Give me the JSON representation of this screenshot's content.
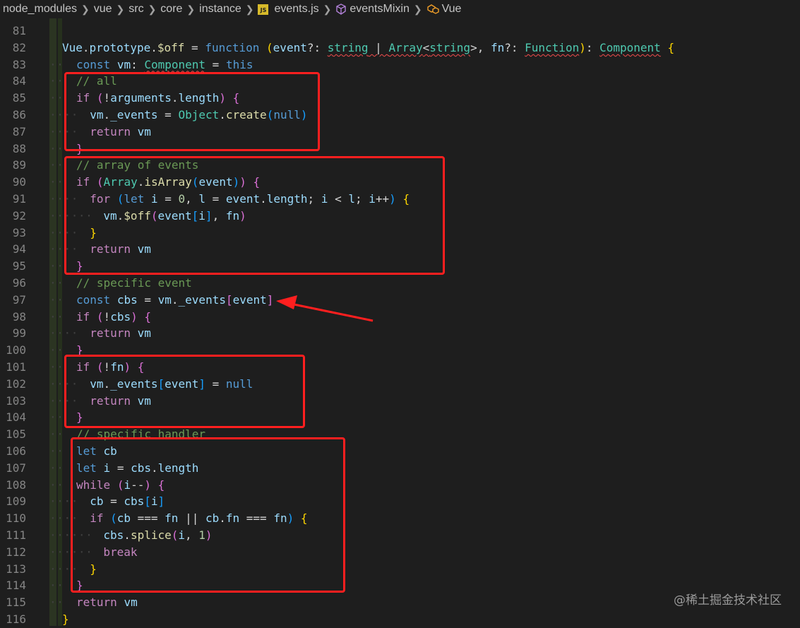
{
  "breadcrumb": {
    "items": [
      "node_modules",
      "vue",
      "src",
      "core",
      "instance"
    ],
    "file": "events.js",
    "file_icon_label": "JS",
    "symbol": "eventsMixin",
    "symbol2": "Vue"
  },
  "lines": [
    {
      "n": "81",
      "dots": ""
    },
    {
      "n": "82",
      "dots": ""
    },
    {
      "n": "83",
      "dots": "··"
    },
    {
      "n": "84",
      "dots": "··"
    },
    {
      "n": "85",
      "dots": "··"
    },
    {
      "n": "86",
      "dots": "····"
    },
    {
      "n": "87",
      "dots": "····"
    },
    {
      "n": "88",
      "dots": "··"
    },
    {
      "n": "89",
      "dots": "··"
    },
    {
      "n": "90",
      "dots": "··"
    },
    {
      "n": "91",
      "dots": "····"
    },
    {
      "n": "92",
      "dots": "······"
    },
    {
      "n": "93",
      "dots": "····"
    },
    {
      "n": "94",
      "dots": "····"
    },
    {
      "n": "95",
      "dots": "··"
    },
    {
      "n": "96",
      "dots": "··"
    },
    {
      "n": "97",
      "dots": "··"
    },
    {
      "n": "98",
      "dots": "··"
    },
    {
      "n": "99",
      "dots": "····"
    },
    {
      "n": "100",
      "dots": "··"
    },
    {
      "n": "101",
      "dots": "··"
    },
    {
      "n": "102",
      "dots": "····"
    },
    {
      "n": "103",
      "dots": "····"
    },
    {
      "n": "104",
      "dots": "··"
    },
    {
      "n": "105",
      "dots": "··"
    },
    {
      "n": "106",
      "dots": "··"
    },
    {
      "n": "107",
      "dots": "··"
    },
    {
      "n": "108",
      "dots": "··"
    },
    {
      "n": "109",
      "dots": "····"
    },
    {
      "n": "110",
      "dots": "····"
    },
    {
      "n": "111",
      "dots": "······"
    },
    {
      "n": "112",
      "dots": "······"
    },
    {
      "n": "113",
      "dots": "····"
    },
    {
      "n": "114",
      "dots": "··"
    },
    {
      "n": "115",
      "dots": "··"
    },
    {
      "n": "116",
      "dots": ""
    }
  ],
  "code": {
    "l82": {
      "obj": "Vue",
      "p1": "prototype",
      "p2": "$off",
      "eq": " = ",
      "kw": "function",
      "arg1": "event",
      "q1": "?: ",
      "t1": "string",
      "pipe": " | ",
      "t2": "Array",
      "t3": "string",
      "arg2": "fn",
      "q2": "?: ",
      "t4": "Function",
      "ret": "Component"
    },
    "l83": {
      "kw": "const",
      "v": "vm",
      "t": "Component",
      "eq": " = ",
      "this": "this"
    },
    "l84": {
      "c": "// all"
    },
    "l85": {
      "kw": "if",
      "arg": "arguments",
      "prop": "length"
    },
    "l86": {
      "v": "vm",
      "prop": "_events",
      "eq": " = ",
      "cls": "Object",
      "fn": "create",
      "arg": "null"
    },
    "l87": {
      "kw": "return",
      "v": "vm"
    },
    "l89": {
      "c": "// array of events"
    },
    "l90": {
      "kw": "if",
      "cls": "Array",
      "fn": "isArray",
      "arg": "event"
    },
    "l91": {
      "kw": "for",
      "let": "let",
      "i": "i",
      "zero": "0",
      "l": "l",
      "ev": "event",
      "len": "length"
    },
    "l92": {
      "v": "vm",
      "fn": "$off",
      "ev": "event",
      "i": "i",
      "fnv": "fn"
    },
    "l94": {
      "kw": "return",
      "v": "vm"
    },
    "l96": {
      "c": "// specific event"
    },
    "l97": {
      "kw": "const",
      "v": "cbs",
      "vm": "vm",
      "prop": "_events",
      "ev": "event"
    },
    "l98": {
      "kw": "if",
      "v": "cbs"
    },
    "l99": {
      "kw": "return",
      "v": "vm"
    },
    "l101": {
      "kw": "if",
      "v": "fn"
    },
    "l102": {
      "v": "vm",
      "prop": "_events",
      "ev": "event",
      "nul": "null"
    },
    "l103": {
      "kw": "return",
      "v": "vm"
    },
    "l105": {
      "c": "// specific handler"
    },
    "l106": {
      "kw": "let",
      "v": "cb"
    },
    "l107": {
      "kw": "let",
      "v": "i",
      "cbs": "cbs",
      "prop": "length"
    },
    "l108": {
      "kw": "while",
      "v": "i"
    },
    "l109": {
      "v": "cb",
      "cbs": "cbs",
      "i": "i"
    },
    "l110": {
      "kw": "if",
      "cb": "cb",
      "fn": "fn",
      "cb2": "cb",
      "p": "fn",
      "fn2": "fn"
    },
    "l111": {
      "cbs": "cbs",
      "m": "splice",
      "i": "i",
      "one": "1"
    },
    "l112": {
      "kw": "break"
    },
    "l115": {
      "kw": "return",
      "v": "vm"
    }
  },
  "watermark": "@稀土掘金技术社区",
  "colors": {
    "annotation": "#ff1f1f",
    "background": "#1e1e1e"
  }
}
